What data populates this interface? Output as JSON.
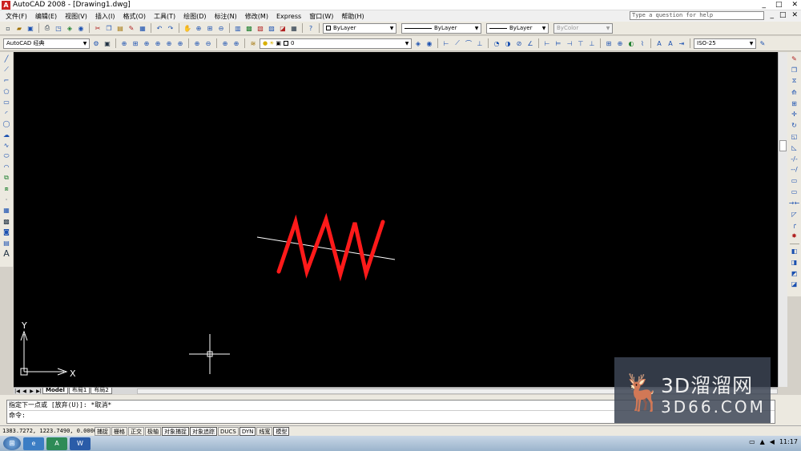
{
  "title": {
    "text": "AutoCAD 2008 - [Drawing1.dwg]",
    "min": "_",
    "max": "□",
    "close": "✕"
  },
  "menu": {
    "items": [
      "文件(F)",
      "编辑(E)",
      "视图(V)",
      "插入(I)",
      "格式(O)",
      "工具(T)",
      "绘图(D)",
      "标注(N)",
      "修改(M)",
      "Express",
      "窗口(W)",
      "帮助(H)"
    ],
    "help_placeholder": "Type a question for help",
    "doc_min": "_",
    "doc_max": "□",
    "doc_close": "✕"
  },
  "toolbar1": {
    "icons": [
      "new-icon",
      "open-icon",
      "save-icon",
      "print-icon",
      "preview-icon",
      "publish-icon",
      "3dprint-icon",
      "cut-icon",
      "copy-icon",
      "paste-icon",
      "matchprop-icon",
      "blockeditor-icon",
      "undo-icon",
      "redo-icon",
      "pan-icon",
      "zoom-realtime-icon",
      "zoom-window-icon",
      "zoom-previous-icon",
      "properties-icon",
      "designcenter-icon",
      "toolpalettes-icon",
      "sheetset-icon",
      "markup-icon",
      "calc-icon",
      "help-icon"
    ],
    "layer_combo": "ByLayer",
    "linetype_combo": "ByLayer",
    "lineweight_combo": "ByLayer",
    "color_combo": "ByColor"
  },
  "toolbar2": {
    "workspace": "AutoCAD 经典",
    "layer_value": "0",
    "dimstyle": "ISO-25"
  },
  "colors": {
    "canvas": "#000000",
    "zigzag": "#ff1a1a",
    "line": "#ffffff",
    "accent": "#1a50b0"
  },
  "drawing": {
    "ucs_x": "X",
    "ucs_y": "Y"
  },
  "layout_tabs": {
    "nav": [
      "|◀",
      "◀",
      "▶",
      "▶|"
    ],
    "tabs": [
      "Model",
      "布局1",
      "布局2"
    ]
  },
  "command": {
    "line1": "指定下一点或 [放弃(U)]: *取消*",
    "line2": "命令:"
  },
  "status": {
    "coords": "1383.7272, 1223.7490, 0.0000",
    "buttons": [
      "捕捉",
      "栅格",
      "正交",
      "极轴",
      "对象捕捉",
      "对象追踪",
      "DUCS",
      "DYN",
      "线宽",
      "模型"
    ]
  },
  "taskbar": {
    "time": "11:17"
  },
  "watermark": {
    "logo": "3D溜溜网",
    "site": "3D66.COM"
  }
}
